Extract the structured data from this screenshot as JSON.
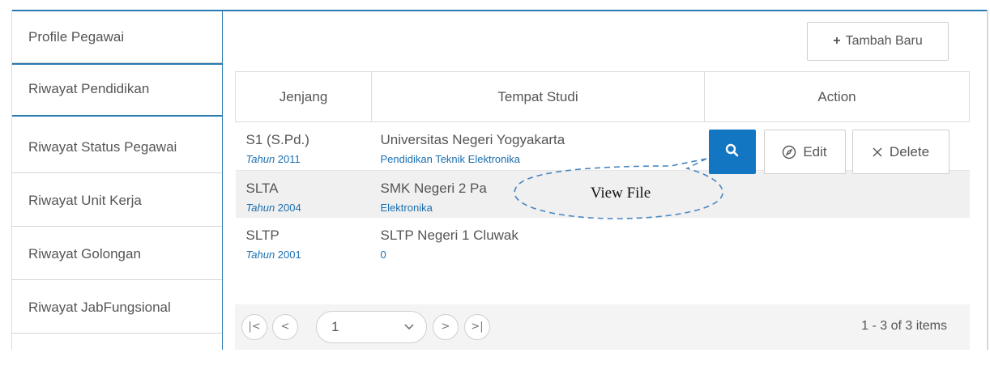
{
  "sidebar": {
    "items": [
      {
        "label": "Profile Pegawai"
      },
      {
        "label": "Riwayat Pendidikan"
      },
      {
        "label": "Riwayat Status Pegawai"
      },
      {
        "label": "Riwayat Unit Kerja"
      },
      {
        "label": "Riwayat Golongan"
      },
      {
        "label": "Riwayat JabFungsional"
      }
    ],
    "active_index": 1
  },
  "toolbar": {
    "add_label": "Tambah Baru",
    "add_icon": "plus-icon"
  },
  "table": {
    "headers": [
      "Jenjang",
      "Tempat Studi",
      "Action"
    ],
    "year_label": "Tahun",
    "rows": [
      {
        "level": "S1 (S.Pd.)",
        "year": "2011",
        "school": "Universitas Negeri Yogyakarta",
        "major": "Pendidikan Teknik Elektronika"
      },
      {
        "level": "SLTA",
        "year": "2004",
        "school": "SMK Negeri 2 Pa",
        "major": "Elektronika"
      },
      {
        "level": "SLTP",
        "year": "2001",
        "school": "SLTP Negeri 1 Cluwak",
        "major": "0"
      }
    ],
    "actions": {
      "view_icon": "search-icon",
      "edit_label": "Edit",
      "edit_icon": "compass-icon",
      "delete_label": "Delete",
      "delete_icon": "close-icon"
    }
  },
  "pager": {
    "first_icon": "first-page-icon",
    "prev_icon": "prev-page-icon",
    "next_icon": "next-page-icon",
    "last_icon": "last-page-icon",
    "current_page": "1",
    "info": "1 - 3 of 3 items"
  },
  "callout": {
    "text": "View File"
  },
  "colors": {
    "accent": "#1276c2",
    "link": "#1a6fb0",
    "alt_row": "#f0f0f0"
  }
}
